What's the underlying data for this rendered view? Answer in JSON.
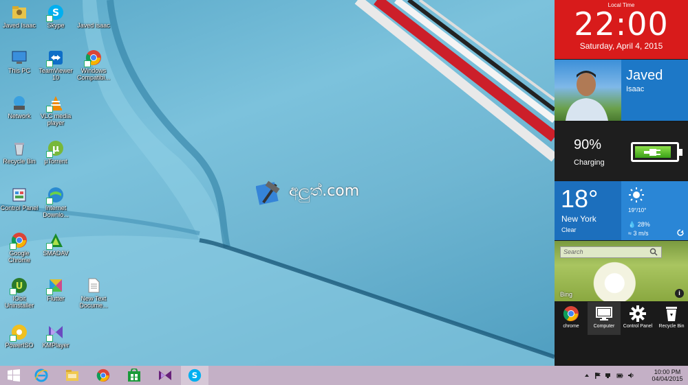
{
  "desktop": {
    "icons": [
      {
        "label": "Javed Isaac",
        "icon": "user-folder-icon"
      },
      {
        "label": "Skype",
        "icon": "skype-icon"
      },
      {
        "label": "Javed isaac",
        "icon": "user-folder-icon"
      },
      {
        "label": "This PC",
        "icon": "computer-icon"
      },
      {
        "label": "TeamViewer 10",
        "icon": "teamviewer-icon"
      },
      {
        "label": "Windows Compatibi...",
        "icon": "chrome-icon"
      },
      {
        "label": "Network",
        "icon": "network-icon"
      },
      {
        "label": "VLC media player",
        "icon": "vlc-icon"
      },
      {
        "label": "Recycle Bin",
        "icon": "recycle-bin-icon"
      },
      {
        "label": "µTorrent",
        "icon": "utorrent-icon"
      },
      {
        "label": "Control Panel",
        "icon": "control-panel-icon"
      },
      {
        "label": "Internet Downlo...",
        "icon": "idm-icon"
      },
      {
        "label": "Google Chrome",
        "icon": "chrome-icon"
      },
      {
        "label": "SMADAV",
        "icon": "smadav-icon"
      },
      {
        "label": "IObit Uninstaller",
        "icon": "iobit-icon"
      },
      {
        "label": "Flutter",
        "icon": "flutter-icon"
      },
      {
        "label": "New Text Docume...",
        "icon": "text-document-icon"
      },
      {
        "label": "PowerISO",
        "icon": "poweriso-icon"
      },
      {
        "label": "KMPlayer",
        "icon": "kmplayer-icon"
      }
    ],
    "logo_text": "අලුත්.com"
  },
  "panel": {
    "clock": {
      "caption": "Local Time",
      "time": "22:00",
      "date": "Saturday, April 4, 2015"
    },
    "user": {
      "first": "Javed",
      "last": "Isaac"
    },
    "battery": {
      "percent_text": "90%",
      "state": "Charging",
      "level": 0.9
    },
    "weather": {
      "temp": "18°",
      "city": "New York",
      "condition": "Clear",
      "range": "19°/10°",
      "humidity": "28%",
      "wind": "3 m/s"
    },
    "bing": {
      "search_placeholder": "Search",
      "label": "Bing"
    },
    "quick": [
      {
        "label": "chrome",
        "icon": "chrome-icon"
      },
      {
        "label": "Computer",
        "icon": "monitor-icon"
      },
      {
        "label": "Control Panel",
        "icon": "gear-icon"
      },
      {
        "label": "Recycle Bin",
        "icon": "recycle-bin-icon"
      }
    ]
  },
  "taskbar": {
    "apps": [
      {
        "icon": "windows-start-icon"
      },
      {
        "icon": "internet-explorer-icon"
      },
      {
        "icon": "file-explorer-icon"
      },
      {
        "icon": "chrome-icon"
      },
      {
        "icon": "store-icon"
      },
      {
        "icon": "visual-studio-icon"
      },
      {
        "icon": "skype-icon"
      }
    ],
    "clock_time": "10:00 PM",
    "clock_date": "04/04/2015"
  },
  "colors": {
    "clock_tile": "#d81b1b",
    "user_tile": "#1d78c7",
    "weather_tile": "#1c6fbd",
    "taskbar": "#c4b0c6"
  }
}
